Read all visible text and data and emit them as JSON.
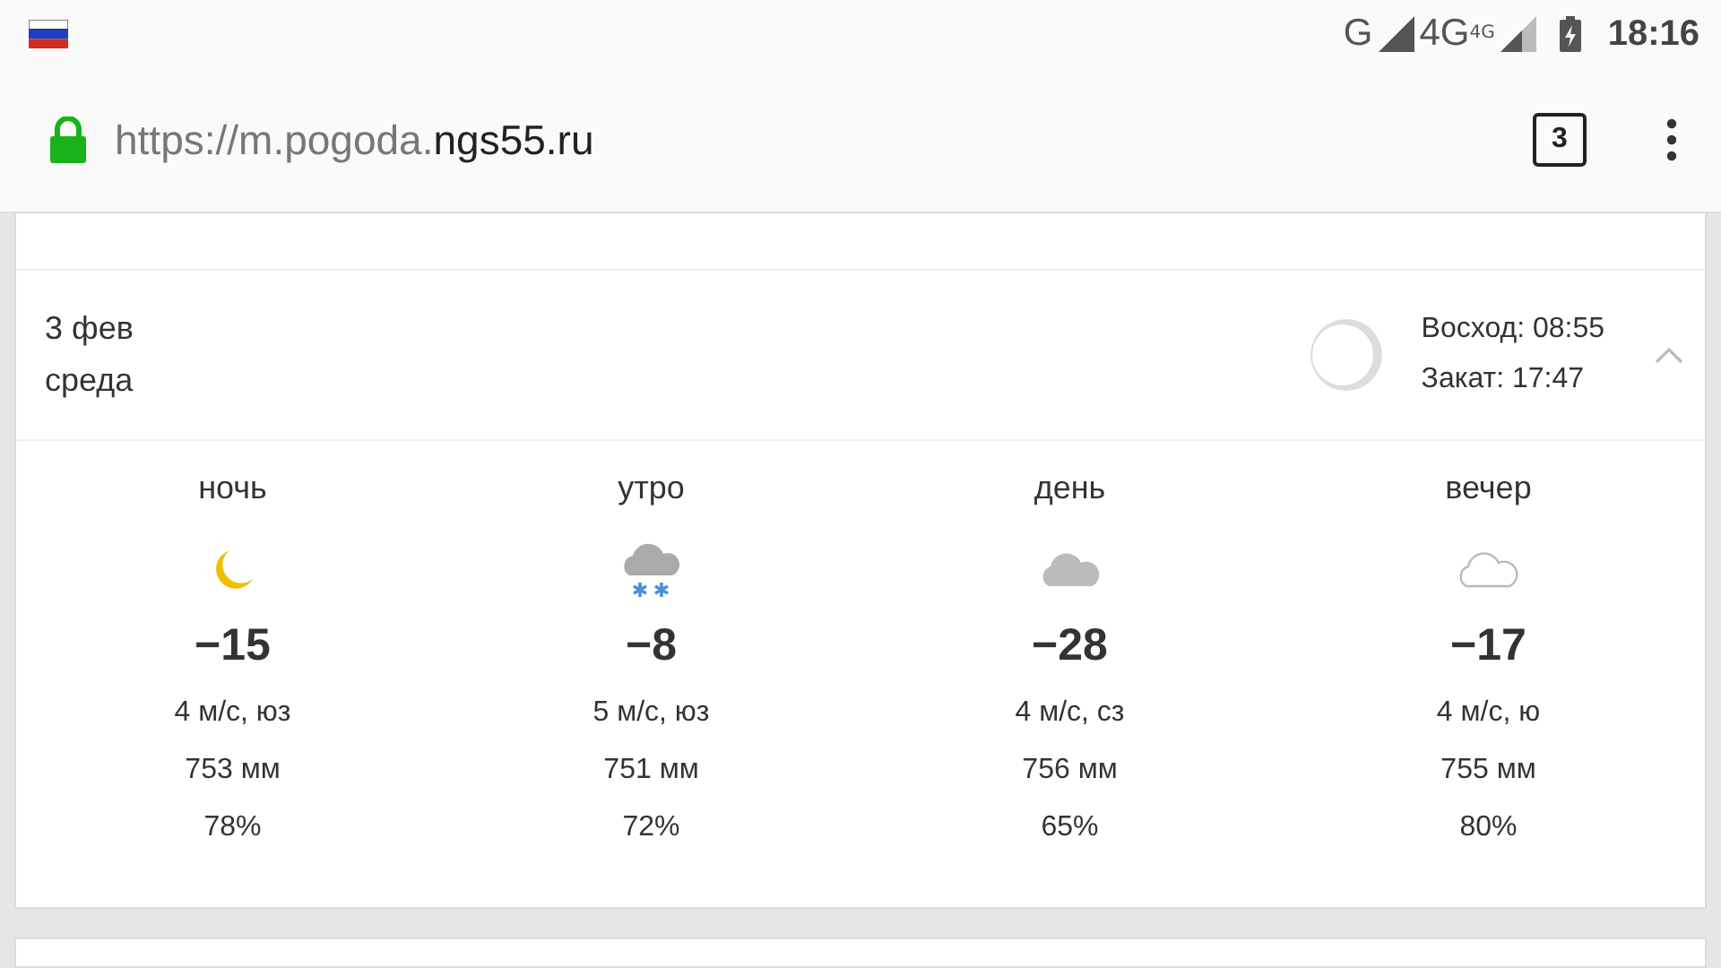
{
  "status_bar": {
    "network": "G",
    "network_2": "4G",
    "network_2_sup": "4G",
    "time": "18:16"
  },
  "url_bar": {
    "url_muted": "https://m.pogoda.",
    "url_domain": "ngs55.ru",
    "tab_count": "3"
  },
  "day": {
    "date": "3 фев",
    "weekday": "среда",
    "sunrise": "Восход: 08:55",
    "sunset": "Закат: 17:47",
    "expanded": true
  },
  "periods": [
    {
      "name": "ночь",
      "kind": "moon",
      "temp": "−15",
      "wind": "4 м/с, юз",
      "pressure": "753 мм",
      "humidity": "78%"
    },
    {
      "name": "утро",
      "kind": "snow",
      "temp": "−8",
      "wind": "5 м/с, юз",
      "pressure": "751 мм",
      "humidity": "72%"
    },
    {
      "name": "день",
      "kind": "cloud",
      "temp": "−28",
      "wind": "4 м/с, сз",
      "pressure": "756 мм",
      "humidity": "65%"
    },
    {
      "name": "вечер",
      "kind": "cloud-outline",
      "temp": "−17",
      "wind": "4 м/с, ю",
      "pressure": "755 мм",
      "humidity": "80%"
    }
  ]
}
